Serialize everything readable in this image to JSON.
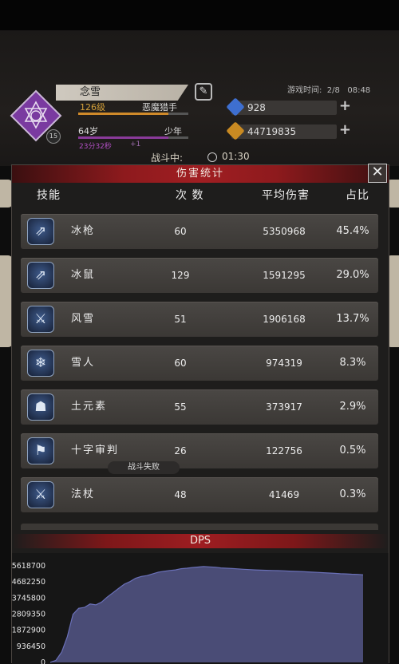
{
  "hud": {
    "player_name": "念雪",
    "rank_level": "126级",
    "rank_title": "恶魔猎手",
    "rank_progress": 0.82,
    "age": "64岁",
    "age_stage": "少年",
    "age_progress": 0.82,
    "age_time": "23分32秒",
    "age_plus": "+1",
    "badge": "15",
    "game_time": "游戏时间:  2/8   08:48",
    "gems": "928",
    "gold": "44719835",
    "battle_status": "战斗中:",
    "battle_timer": "01:30",
    "colors": {
      "gem": "#3e6fd0",
      "gold": "#c98a22",
      "accent": "#a01e22"
    }
  },
  "panel": {
    "title": "伤害统计",
    "close": "✕",
    "headers": {
      "skill": "技能",
      "count": "次  数",
      "avg": "平均伤害",
      "pct": "占比"
    },
    "rows": [
      {
        "icon": "spear-icon",
        "glyph": "⇗",
        "skill": "冰枪",
        "count": "60",
        "avg": "5350968",
        "pct": "45.4%"
      },
      {
        "icon": "spear-icon",
        "glyph": "⇗",
        "skill": "冰鼠",
        "count": "129",
        "avg": "1591295",
        "pct": "29.0%"
      },
      {
        "icon": "sword-icon",
        "glyph": "⚔",
        "skill": "风雪",
        "count": "51",
        "avg": "1906168",
        "pct": "13.7%"
      },
      {
        "icon": "snowflake-icon",
        "glyph": "❄",
        "skill": "雪人",
        "count": "60",
        "avg": "974319",
        "pct": "8.3%"
      },
      {
        "icon": "earth-elemental-icon",
        "glyph": "☗",
        "skill": "土元素",
        "count": "55",
        "avg": "373917",
        "pct": "2.9%"
      },
      {
        "icon": "banner-icon",
        "glyph": "⚑",
        "skill": "十字审判",
        "count": "26",
        "avg": "122756",
        "pct": "0.5%"
      },
      {
        "icon": "sword-icon",
        "glyph": "⚔",
        "skill": "法杖",
        "count": "48",
        "avg": "41469",
        "pct": "0.3%"
      }
    ],
    "toast": "战斗失败"
  },
  "dps": {
    "title": "DPS"
  },
  "chart_data": {
    "type": "area",
    "title": "DPS",
    "xlabel": "",
    "ylabel": "",
    "y_ticks": [
      "0",
      "936450",
      "1872900",
      "2809350",
      "3745800",
      "4682250",
      "5618700"
    ],
    "ylim": [
      0,
      5618700
    ],
    "grid": false,
    "color": "#4a4c76",
    "line_color": "#6a70b8",
    "values": [
      0,
      120000,
      600000,
      1500000,
      2800000,
      3150000,
      3200000,
      3400000,
      3350000,
      3500000,
      3800000,
      4050000,
      4300000,
      4550000,
      4700000,
      4900000,
      5000000,
      5050000,
      5150000,
      5250000,
      5300000,
      5350000,
      5380000,
      5450000,
      5480000,
      5520000,
      5550000,
      5580000,
      5560000,
      5540000,
      5500000,
      5480000,
      5460000,
      5440000,
      5420000,
      5400000,
      5380000,
      5370000,
      5360000,
      5350000,
      5340000,
      5330000,
      5310000,
      5300000,
      5290000,
      5270000,
      5250000,
      5240000,
      5220000,
      5200000,
      5180000,
      5160000,
      5150000,
      5130000,
      5120000,
      5100000
    ]
  }
}
